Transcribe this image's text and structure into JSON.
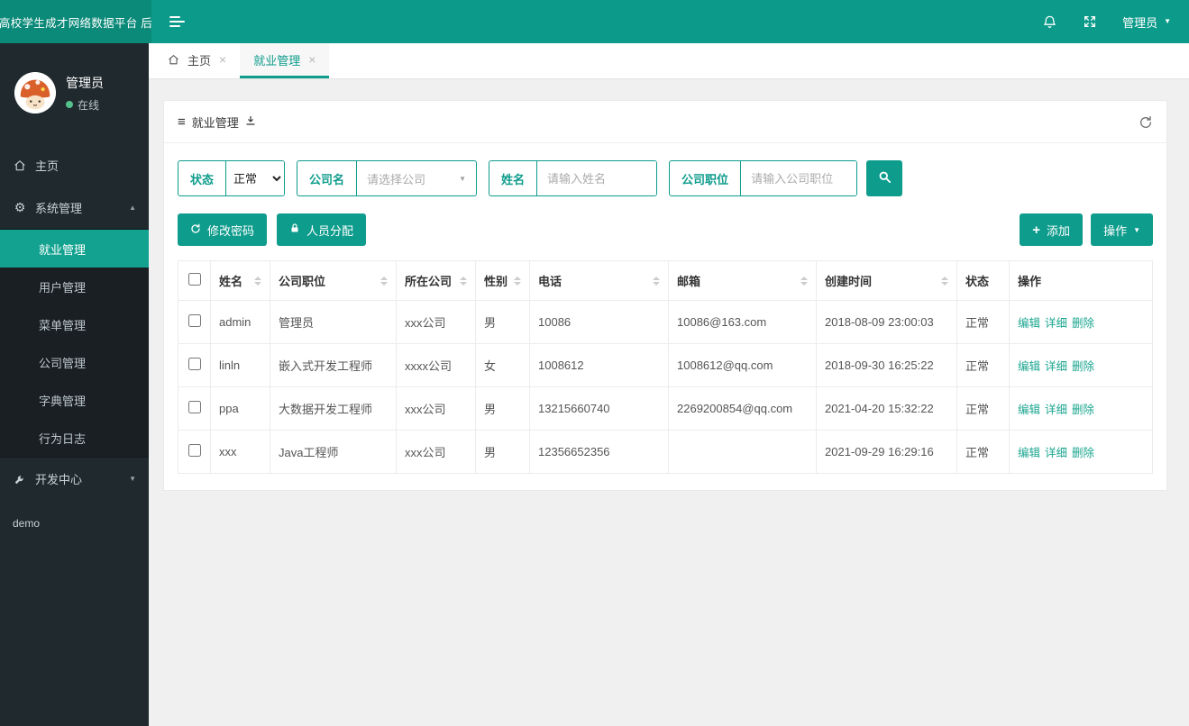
{
  "topbar": {
    "brand": "高校学生成才网络数据平台 后",
    "user_label": "管理员"
  },
  "glyphs": {
    "close": "×",
    "caret_down": "▼",
    "caret_up": "▲",
    "list": "≡",
    "gear": "⚙",
    "plus": "+"
  },
  "sidebar": {
    "user": {
      "name": "管理员",
      "status": "在线"
    },
    "menu": [
      {
        "label": "主页"
      },
      {
        "label": "系统管理"
      },
      {
        "label": "就业管理"
      },
      {
        "label": "用户管理"
      },
      {
        "label": "菜单管理"
      },
      {
        "label": "公司管理"
      },
      {
        "label": "字典管理"
      },
      {
        "label": "行为日志"
      },
      {
        "label": "开发中心"
      },
      {
        "label": "demo"
      }
    ]
  },
  "tabs": [
    {
      "label": "主页"
    },
    {
      "label": "就业管理"
    }
  ],
  "panel": {
    "title": "就业管理",
    "filters": {
      "status": {
        "label": "状态",
        "value": "正常"
      },
      "company": {
        "label": "公司名",
        "placeholder": "请选择公司"
      },
      "name": {
        "label": "姓名",
        "placeholder": "请输入姓名"
      },
      "position": {
        "label": "公司职位",
        "placeholder": "请输入公司职位"
      }
    },
    "toolbar": {
      "change_password": "修改密码",
      "assign_people": "人员分配",
      "add": "添加",
      "operation": "操作"
    },
    "table": {
      "columns": [
        "姓名",
        "公司职位",
        "所在公司",
        "性别",
        "电话",
        "邮箱",
        "创建时间",
        "状态",
        "操作"
      ],
      "row_actions": [
        "编辑",
        "详细",
        "删除"
      ],
      "rows": [
        {
          "name": "admin",
          "position": "管理员",
          "company": "xxx公司",
          "gender": "男",
          "phone": "10086",
          "email": "10086@163.com",
          "created": "2018-08-09 23:00:03",
          "status": "正常"
        },
        {
          "name": "linln",
          "position": "嵌入式开发工程师",
          "company": "xxxx公司",
          "gender": "女",
          "phone": "1008612",
          "email": "1008612@qq.com",
          "created": "2018-09-30 16:25:22",
          "status": "正常"
        },
        {
          "name": "ppa",
          "position": "大数据开发工程师",
          "company": "xxx公司",
          "gender": "男",
          "phone": "13215660740",
          "email": "2269200854@qq.com",
          "created": "2021-04-20 15:32:22",
          "status": "正常"
        },
        {
          "name": "xxx",
          "position": "Java工程师",
          "company": "xxx公司",
          "gender": "男",
          "phone": "12356652356",
          "email": "",
          "created": "2021-09-29 16:29:16",
          "status": "正常"
        }
      ]
    }
  },
  "colors": {
    "topbar": "#0c9b8a",
    "brand_bg": "#0b8a79",
    "accent": "#0e9c8c",
    "sidebar_bg": "#20292e",
    "submenu_bg": "#191f23",
    "active_item": "#12a28f",
    "online_dot": "#54c08a",
    "link": "#1aa58f"
  }
}
